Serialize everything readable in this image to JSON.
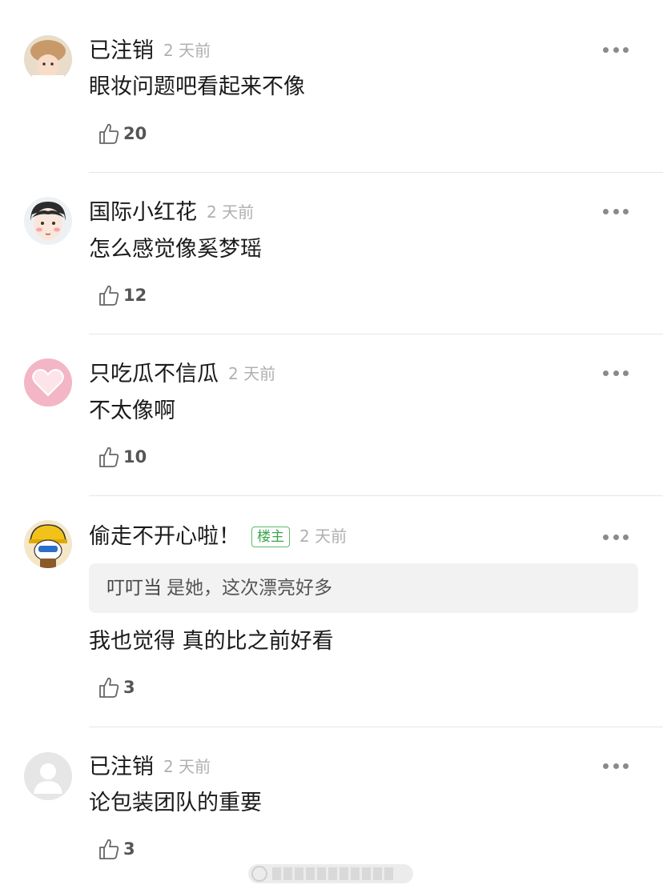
{
  "comments": [
    {
      "name": "已注销",
      "time": "2 天前",
      "text": "眼妆问题吧看起来不像",
      "likes": "20",
      "avatar": "avatar-cartoon-hat"
    },
    {
      "name": "国际小红花",
      "time": "2 天前",
      "text": "怎么感觉像奚梦瑶",
      "likes": "12",
      "avatar": "avatar-cartoon-face"
    },
    {
      "name": "只吃瓜不信瓜",
      "time": "2 天前",
      "text": "不太像啊",
      "likes": "10",
      "avatar": "avatar-pink-heart"
    },
    {
      "name": "偷走不开心啦！",
      "badge": "楼主",
      "time": "2 天前",
      "quote_name": "叮叮当",
      "quote_text": "是她，这次漂亮好多",
      "text": "我也觉得 真的比之前好看",
      "likes": "3",
      "avatar": "avatar-cartoon-worker"
    },
    {
      "name": "已注销",
      "time": "2 天前",
      "text": "论包装团队的重要",
      "likes": "3",
      "avatar": "avatar-default-user"
    }
  ],
  "colors": {
    "badge": "#3aa64c",
    "time": "#b0b0b0",
    "divider": "#e6e6e6",
    "quote_bg": "#f2f2f2"
  }
}
